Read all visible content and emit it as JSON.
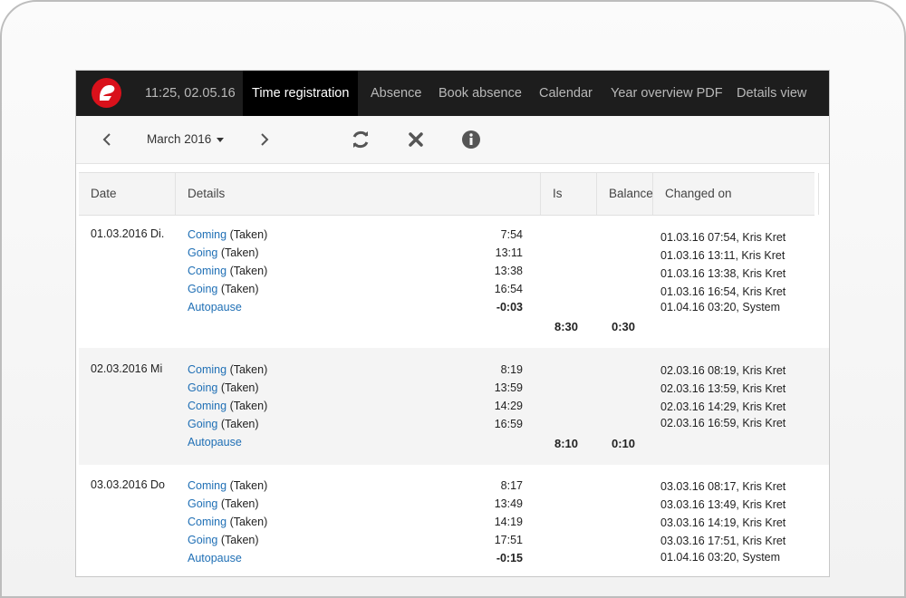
{
  "nav": {
    "clock": "11:25, 02.05.16",
    "items": [
      "Time registration",
      "Absence",
      "Book absence",
      "Calendar",
      "Year overview PDF",
      "Details view"
    ]
  },
  "toolbar": {
    "month": "March 2016"
  },
  "table": {
    "headers": [
      "Date",
      "Details",
      "Is",
      "Balance",
      "Changed on"
    ],
    "days": [
      {
        "date": "01.03.2016 Di.",
        "entries": [
          {
            "kind": "Coming",
            "status": "(Taken)",
            "time": "7:54",
            "changed": "01.03.16 07:54, Kris  Kret"
          },
          {
            "kind": "Going",
            "status": "(Taken)",
            "time": "13:11",
            "changed": "01.03.16 13:11, Kris  Kret"
          },
          {
            "kind": "Coming",
            "status": "(Taken)",
            "time": "13:38",
            "changed": "01.03.16 13:38, Kris  Kret"
          },
          {
            "kind": "Going",
            "status": "(Taken)",
            "time": "16:54",
            "changed": "01.03.16 16:54, Kris  Kret"
          },
          {
            "kind": "Autopause",
            "status": "",
            "time": "-0:03",
            "changed": "01.04.16 03:20, System"
          }
        ],
        "is": "8:30",
        "balance": "0:30"
      },
      {
        "date": "02.03.2016 Mi",
        "entries": [
          {
            "kind": "Coming",
            "status": "(Taken)",
            "time": "8:19",
            "changed": "02.03.16 08:19, Kris Kret"
          },
          {
            "kind": "Going",
            "status": "(Taken)",
            "time": "13:59",
            "changed": "02.03.16 13:59, Kris Kret"
          },
          {
            "kind": "Coming",
            "status": "(Taken)",
            "time": "14:29",
            "changed": "02.03.16 14:29, Kris Kret"
          },
          {
            "kind": "Going",
            "status": "(Taken)",
            "time": "16:59",
            "changed": "02.03.16 16:59, Kris Kret"
          },
          {
            "kind": "Autopause",
            "status": "",
            "time": "",
            "changed": ""
          }
        ],
        "is": "8:10",
        "balance": "0:10"
      },
      {
        "date": "03.03.2016 Do",
        "entries": [
          {
            "kind": "Coming",
            "status": "(Taken)",
            "time": "8:17",
            "changed": "03.03.16 08:17, Kris Kret"
          },
          {
            "kind": "Going",
            "status": "(Taken)",
            "time": "13:49",
            "changed": "03.03.16 13:49, Kris Kret"
          },
          {
            "kind": "Coming",
            "status": "(Taken)",
            "time": "14:19",
            "changed": "03.03.16 14:19, Kris Kret"
          },
          {
            "kind": "Going",
            "status": "(Taken)",
            "time": "17:51",
            "changed": "03.03.16 17:51, Kris Kret"
          },
          {
            "kind": "Autopause",
            "status": "",
            "time": "-0:15",
            "changed": "01.04.16 03:20, System"
          }
        ],
        "is": "",
        "balance": ""
      }
    ]
  }
}
